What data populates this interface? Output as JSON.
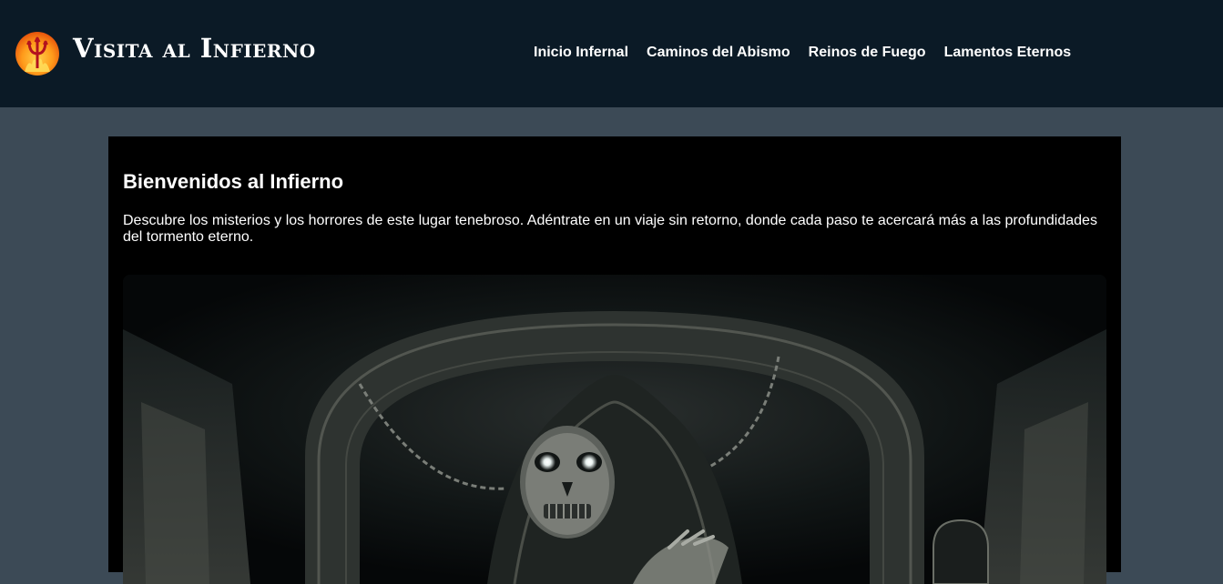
{
  "header": {
    "site_title": "Visita al Infierno",
    "logo_icon": "trident-flame-logo",
    "nav": [
      {
        "label": "Inicio Infernal"
      },
      {
        "label": "Caminos del Abismo"
      },
      {
        "label": "Reinos de Fuego"
      },
      {
        "label": "Lamentos Eternos"
      }
    ]
  },
  "main": {
    "heading": "Bienvenidos al Infierno",
    "intro": "Descubre los misterios y los horrores de este lugar tenebroso. Adéntrate en un viaje sin retorno, donde cada paso te acercará más a las profundidades del tormento eterno.",
    "hero_image": "hooded-skull-reaper-under-stone-archway"
  },
  "colors": {
    "header_bg": "#0b1a26",
    "page_bg": "#3c4a56",
    "panel_bg": "#000000",
    "text": "#ffffff",
    "logo_orange": "#ff9a1a"
  }
}
